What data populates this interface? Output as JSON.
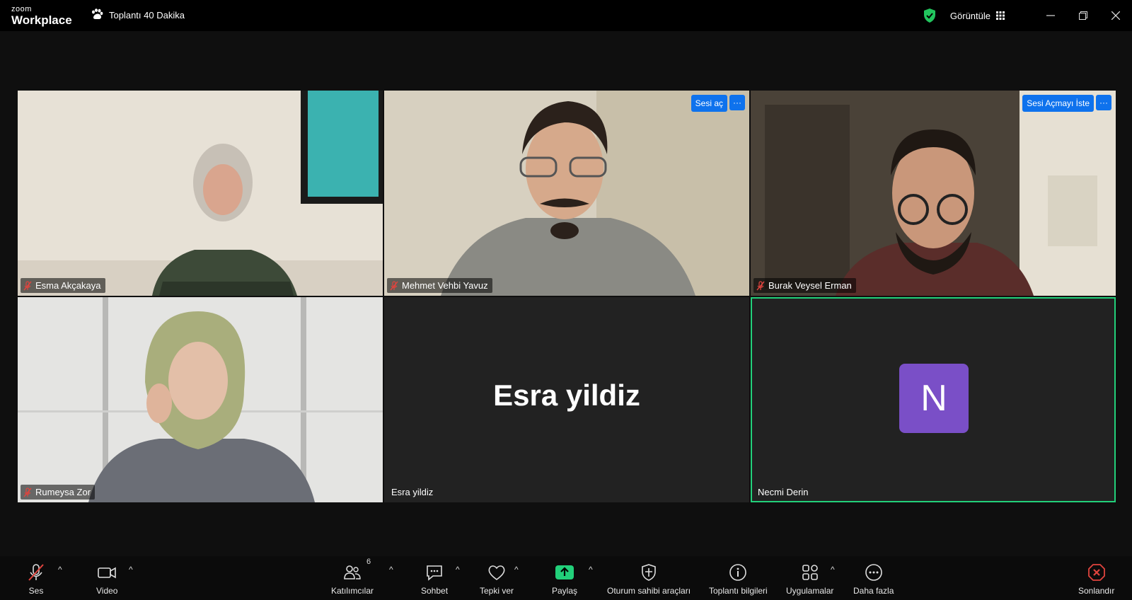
{
  "app": {
    "logo_small": "zoom",
    "logo_large": "Workplace"
  },
  "meeting": {
    "title": "Toplantı 40 Dakika"
  },
  "titlebar": {
    "view_label": "Görüntüle"
  },
  "tiles": [
    {
      "name": "Esma Akçakaya",
      "muted": true
    },
    {
      "name": "Mehmet Vehbi Yavuz",
      "muted": true,
      "action_label": "Sesi aç"
    },
    {
      "name": "Burak Veysel Erman",
      "muted": true,
      "action_label": "Sesi Açmayı İste"
    },
    {
      "name": "Rumeysa Zor",
      "muted": true
    },
    {
      "name": "Esra yildiz",
      "display_name": "Esra yildiz",
      "muted": false
    },
    {
      "name": "Necmi Derin",
      "avatar_letter": "N",
      "muted": false,
      "active_speaker": true
    }
  ],
  "tile_menu_glyph": "···",
  "toolbar": {
    "audio": "Ses",
    "video": "Video",
    "participants": "Katılımcılar",
    "participants_count": "6",
    "chat": "Sohbet",
    "react": "Tepki ver",
    "share": "Paylaş",
    "host_tools": "Oturum sahibi araçları",
    "meeting_info": "Toplantı bilgileri",
    "apps": "Uygulamalar",
    "more": "Daha fazla",
    "end": "Sonlandır",
    "caret": "^"
  },
  "colors": {
    "accent": "#0e72ed",
    "active_border": "#22d07a",
    "share": "#22d07a",
    "avatar": "#7a4fc7",
    "muted": "#e0443e"
  }
}
